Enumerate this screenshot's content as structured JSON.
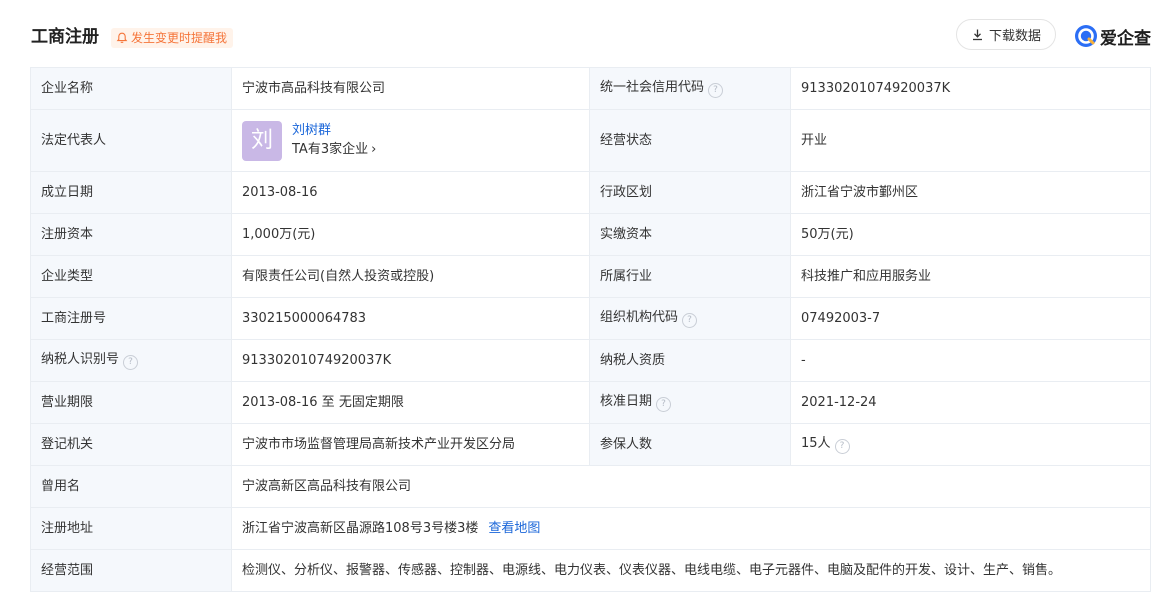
{
  "header": {
    "title": "工商注册",
    "notify_label": "发生变更时提醒我",
    "download_label": "下载数据",
    "brand_name": "爱企查"
  },
  "colors": {
    "accent_orange": "#f5753a",
    "link_blue": "#1a66d9",
    "label_bg": "#f5f8fc",
    "border": "#e9edf2"
  },
  "rows": {
    "company_name": {
      "label": "企业名称",
      "value": "宁波市高品科技有限公司"
    },
    "credit_code": {
      "label": "统一社会信用代码",
      "value": "91330201074920037K"
    },
    "legal_rep": {
      "label": "法定代表人",
      "avatar_char": "刘",
      "name": "刘树群",
      "companies": "TA有3家企业"
    },
    "status": {
      "label": "经营状态",
      "value": "开业"
    },
    "established": {
      "label": "成立日期",
      "value": "2013-08-16"
    },
    "region": {
      "label": "行政区划",
      "value": "浙江省宁波市鄞州区"
    },
    "reg_capital": {
      "label": "注册资本",
      "value": "1,000万(元)"
    },
    "paid_capital": {
      "label": "实缴资本",
      "value": "50万(元)"
    },
    "company_type": {
      "label": "企业类型",
      "value": "有限责任公司(自然人投资或控股)"
    },
    "industry": {
      "label": "所属行业",
      "value": "科技推广和应用服务业"
    },
    "reg_number": {
      "label": "工商注册号",
      "value": "330215000064783"
    },
    "org_code": {
      "label": "组织机构代码",
      "value": "07492003-7"
    },
    "taxpayer_id": {
      "label": "纳税人识别号",
      "value": "91330201074920037K"
    },
    "taxpayer_qual": {
      "label": "纳税人资质",
      "value": "-"
    },
    "term": {
      "label": "营业期限",
      "value": "2013-08-16 至 无固定期限"
    },
    "approval_date": {
      "label": "核准日期",
      "value": "2021-12-24"
    },
    "authority": {
      "label": "登记机关",
      "value": "宁波市市场监督管理局高新技术产业开发区分局"
    },
    "insured": {
      "label": "参保人数",
      "value": "15人"
    },
    "former_name": {
      "label": "曾用名",
      "value": "宁波高新区高品科技有限公司"
    },
    "address": {
      "label": "注册地址",
      "value": "浙江省宁波高新区晶源路108号3号楼3楼",
      "map_link": "查看地图"
    },
    "scope": {
      "label": "经营范围",
      "value": "检测仪、分析仪、报警器、传感器、控制器、电源线、电力仪表、仪表仪器、电线电缆、电子元器件、电脑及配件的开发、设计、生产、销售。"
    }
  },
  "icons": {
    "help": "?",
    "chevron": "›"
  }
}
